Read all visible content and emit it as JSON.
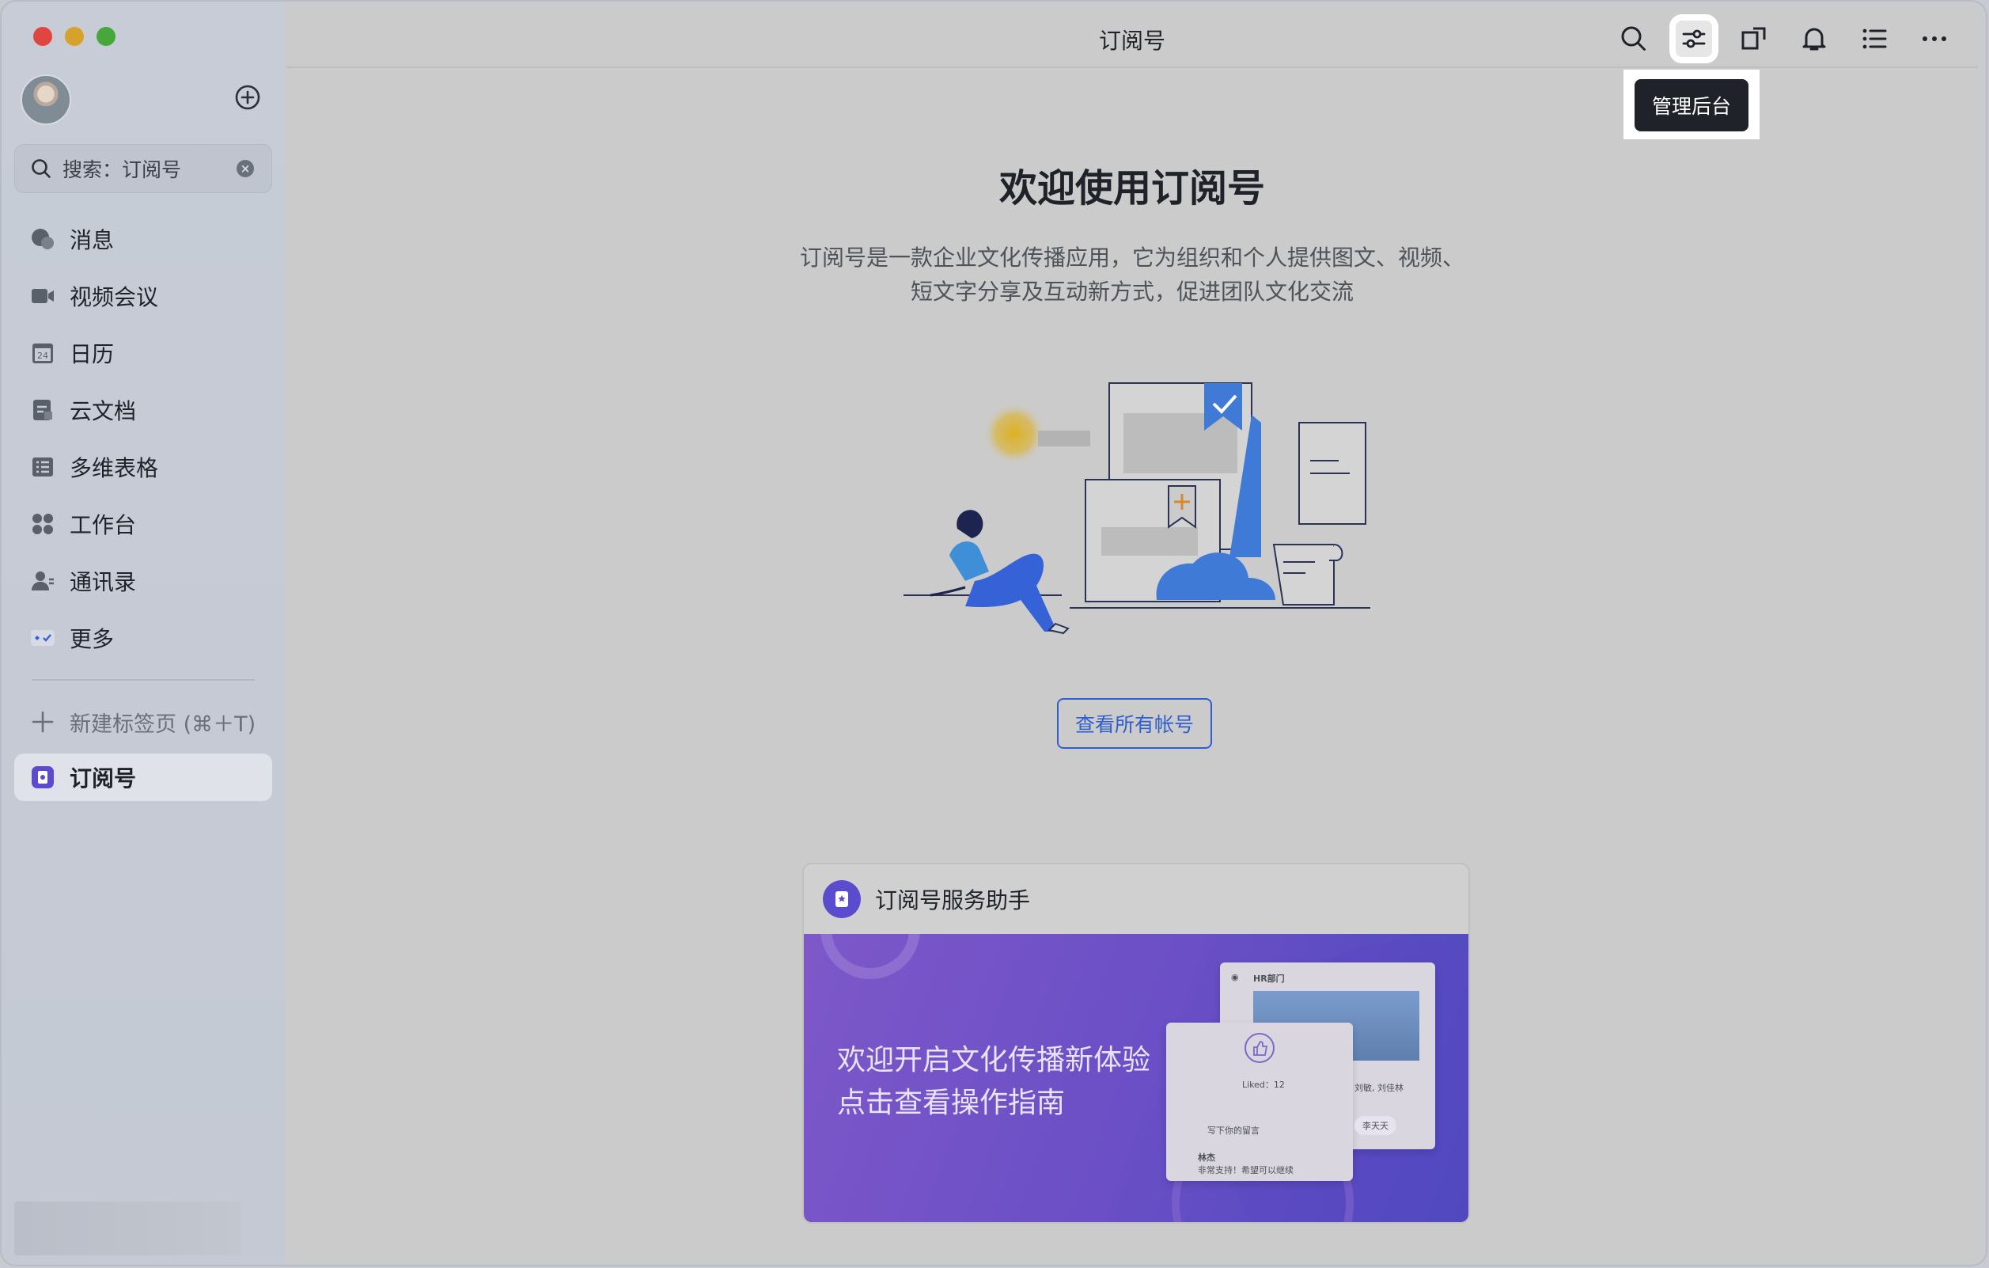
{
  "app": {
    "title": "订阅号"
  },
  "sidebar": {
    "search": {
      "text": "搜索：订阅号"
    },
    "items": [
      {
        "label": "消息",
        "icon": "message-icon"
      },
      {
        "label": "视频会议",
        "icon": "video-icon"
      },
      {
        "label": "日历",
        "icon": "calendar-icon",
        "icon_text": "24"
      },
      {
        "label": "云文档",
        "icon": "document-icon"
      },
      {
        "label": "多维表格",
        "icon": "table-icon"
      },
      {
        "label": "工作台",
        "icon": "workplace-icon"
      },
      {
        "label": "通讯录",
        "icon": "contacts-icon"
      },
      {
        "label": "更多",
        "icon": "more-apps-icon"
      }
    ],
    "new_tab_label": "新建标签页 (⌘＋T)",
    "active_tab": {
      "label": "订阅号",
      "icon": "subscription-icon"
    }
  },
  "toolbar": {
    "icons": [
      "search-icon",
      "settings-sliders-icon",
      "new-window-icon",
      "bell-icon",
      "list-icon",
      "more-icon"
    ],
    "tooltip": "管理后台"
  },
  "main": {
    "heading": "欢迎使用订阅号",
    "description_line1": "订阅号是一款企业文化传播应用，它为组织和个人提供图文、视频、",
    "description_line2": "短文字分享及互动新方式，促进团队文化交流",
    "view_all_button": "查看所有帐号"
  },
  "card": {
    "title": "订阅号服务助手",
    "banner_line1": "欢迎开启文化传播新体验",
    "banner_line2": "点击查看操作指南",
    "mock": {
      "dept": "HR部门",
      "liked": "Liked：12",
      "comment_placeholder": "写下你的留言",
      "commenter": "林杰",
      "comment": "非常支持！希望可以继续",
      "likers": "刘敏, 刘佳林",
      "liker2": "李天天"
    }
  },
  "colors": {
    "accent": "#2f5fcf",
    "tooltip_bg": "#1f2329",
    "banner_start": "#7d58c9",
    "banner_end": "#4b49be",
    "traffic_red": "#e0463f",
    "traffic_yellow": "#d6a22a",
    "traffic_green": "#46a73a"
  }
}
